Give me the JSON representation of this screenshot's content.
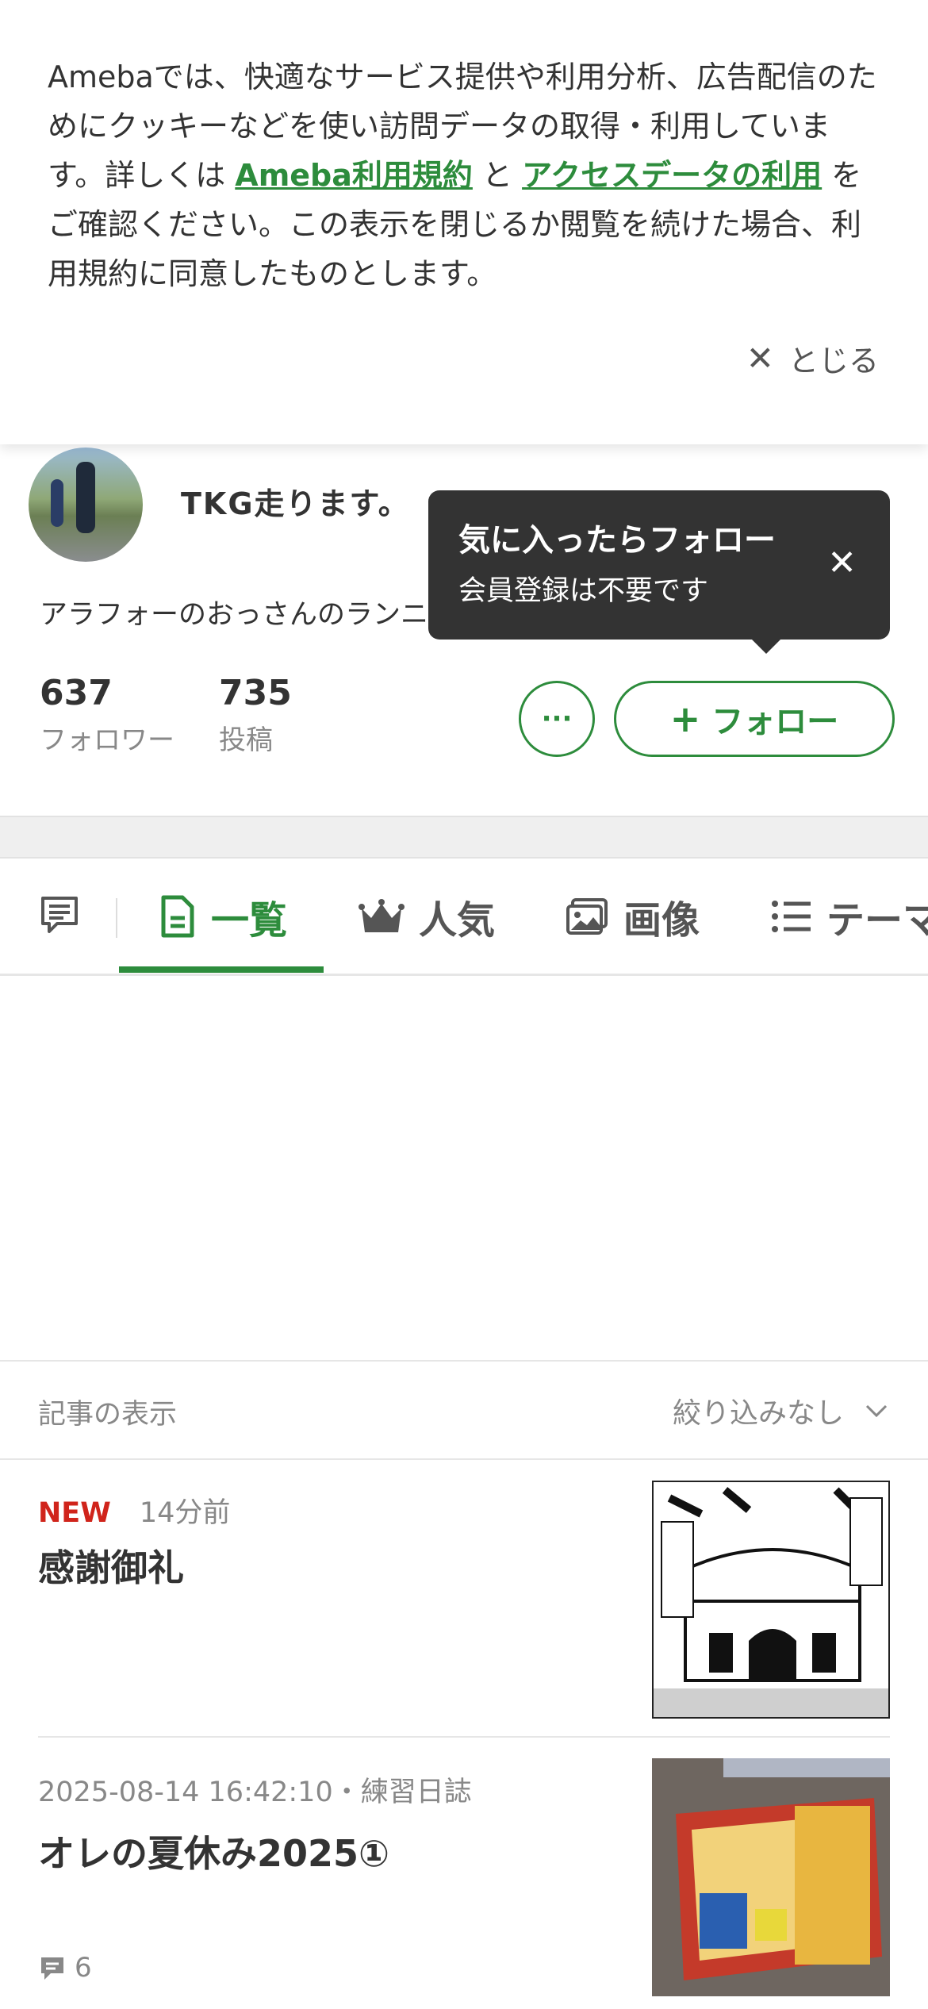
{
  "cookie_banner": {
    "text_part1": "Amebaでは、快適なサービス提供や利用分析、広告配信のためにクッキーなどを使い訪問データの取得・利用しています。詳しくは ",
    "link_terms": "Ameba利用規約",
    "text_and": " と ",
    "link_access": "アクセスデータの利用",
    "text_part2": " をご確認ください。この表示を閉じるか閲覧を続けた場合、利用規約に同意したものとします。",
    "close_label": "とじる"
  },
  "profile": {
    "blog_title": "TKG走ります。",
    "description": "アラフォーのおっさんのランニング",
    "followers_count": "637",
    "followers_label": "フォロワー",
    "posts_count": "735",
    "posts_label": "投稿",
    "more_label": "···",
    "follow_label": "フォロー"
  },
  "tooltip": {
    "title": "気に入ったらフォロー",
    "subtitle": "会員登録は不要です"
  },
  "tabs": [
    {
      "label": "一覧",
      "icon": "document-icon",
      "active": true
    },
    {
      "label": "人気",
      "icon": "crown-icon",
      "active": false
    },
    {
      "label": "画像",
      "icon": "image-icon",
      "active": false
    },
    {
      "label": "テーマ",
      "icon": "list-icon",
      "active": false
    }
  ],
  "filter": {
    "label": "記事の表示",
    "selected": "絞り込みなし"
  },
  "articles": [
    {
      "badge": "NEW",
      "meta": "14分前",
      "title": "感謝御礼"
    },
    {
      "meta": "2025-08-14 16:42:10・練習日誌",
      "title": "オレの夏休み2025①",
      "comments": "6"
    }
  ],
  "colors": {
    "accent": "#2d8c3c",
    "new_badge": "#d0241b",
    "tooltip_bg": "#333333"
  }
}
